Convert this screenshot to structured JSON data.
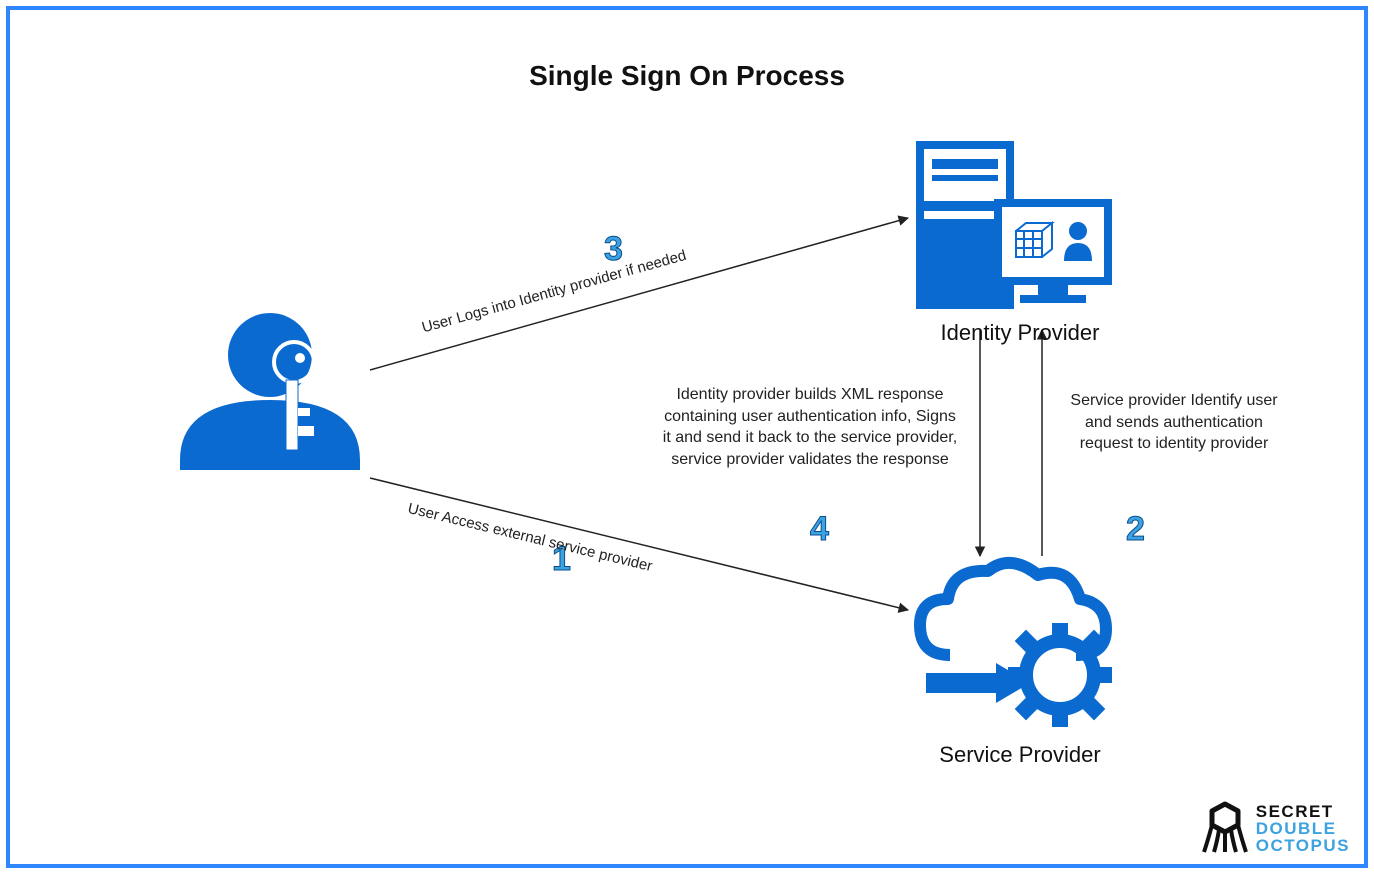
{
  "title": "Single Sign On Process",
  "nodes": {
    "user": {
      "label": ""
    },
    "idp": {
      "label": "Identity Provider"
    },
    "sp": {
      "label": "Service Provider"
    }
  },
  "steps": {
    "s1": {
      "num": "1",
      "edge_text": "User Access external service provider"
    },
    "s2": {
      "num": "2",
      "desc": "Service provider Identify user and sends authentication request to identity provider"
    },
    "s3": {
      "num": "3",
      "edge_text": "User Logs into Identity provider if needed"
    },
    "s4": {
      "num": "4",
      "desc": "Identity provider builds XML response containing user authentication info, Signs it and send it back to the service provider, service provider validates the response"
    }
  },
  "brand": {
    "line1": "SECRET",
    "line2": "DOUBLE",
    "line3": "OCTOPUS"
  },
  "colors": {
    "primary": "#0b6ad0",
    "step": "#3da2e0",
    "frame": "#2f86ff"
  }
}
